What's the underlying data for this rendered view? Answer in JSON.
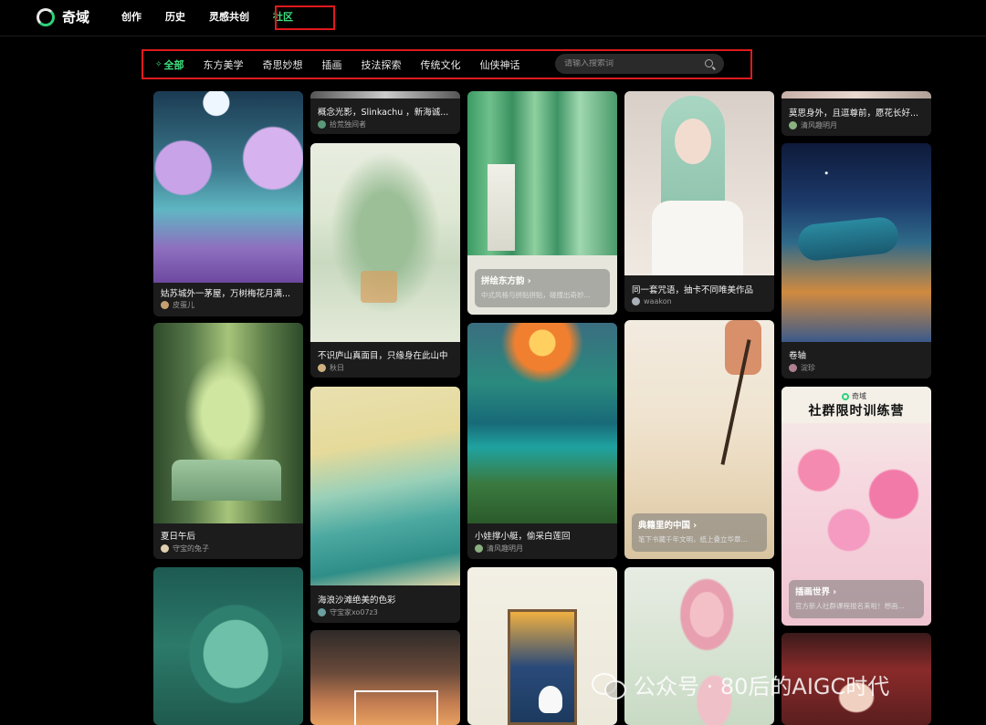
{
  "app": {
    "name": "奇域"
  },
  "nav": {
    "items": [
      "创作",
      "历史",
      "灵感共创",
      "社区"
    ],
    "active_index": 3
  },
  "categories": {
    "items": [
      "全部",
      "东方美学",
      "奇思妙想",
      "插画",
      "技法探索",
      "传统文化",
      "仙侠神话"
    ],
    "active_index": 0
  },
  "search": {
    "placeholder": "请输入搜索词"
  },
  "cards": {
    "c1_1": {
      "title": "姑苏城外一茅屋，万树梅花月满...",
      "author": "皮蛋儿"
    },
    "c1_2": {
      "title": "夏日午后",
      "author": "守宝的兔子"
    },
    "c2_1": {
      "title": "概念光影，Slinkachu ，新海诚...",
      "author": "拾荒独间者"
    },
    "c2_2": {
      "title": "不识庐山真面目，只缘身在此山中",
      "author": "秋日"
    },
    "c2_3": {
      "title": "海浪沙滩绝美的色彩",
      "author": "守宝家xo07z3"
    },
    "c3_1": {
      "overlay_title": "拼绘东方韵 ›",
      "overlay_sub": "中式风格与拼贴拼贴，碰撞出奇妙..."
    },
    "c3_2": {
      "title": "小娃撑小艇，偷采白莲回",
      "author": "清风趣明月"
    },
    "c4_1": {
      "title": "同一套咒语，抽卡不同唯美作品",
      "author": "waakon"
    },
    "c4_2": {
      "overlay_title": "典籍里的中国 ›",
      "overlay_sub": "笔下书藏千年文明，纸上叠立华章..."
    },
    "c5_1": {
      "title": "莫思身外，且逗尊前，愿花长好...",
      "author": "清风趣明月"
    },
    "c5_2": {
      "title": "卷轴",
      "author": "淀珍"
    },
    "c5_3": {
      "poster_brand": "奇域",
      "poster_title": "社群限时训练营",
      "overlay_title": "插画世界 ›",
      "overlay_sub": "官方新人社群课程报名来啦！想画..."
    }
  },
  "watermark": {
    "text": "公众号 · 80后的AIGC时代"
  },
  "colors": {
    "accent": "#3ee07f",
    "highlight_box": "#e0191c",
    "background": "#000000",
    "card_bg": "#1c1c1c"
  }
}
